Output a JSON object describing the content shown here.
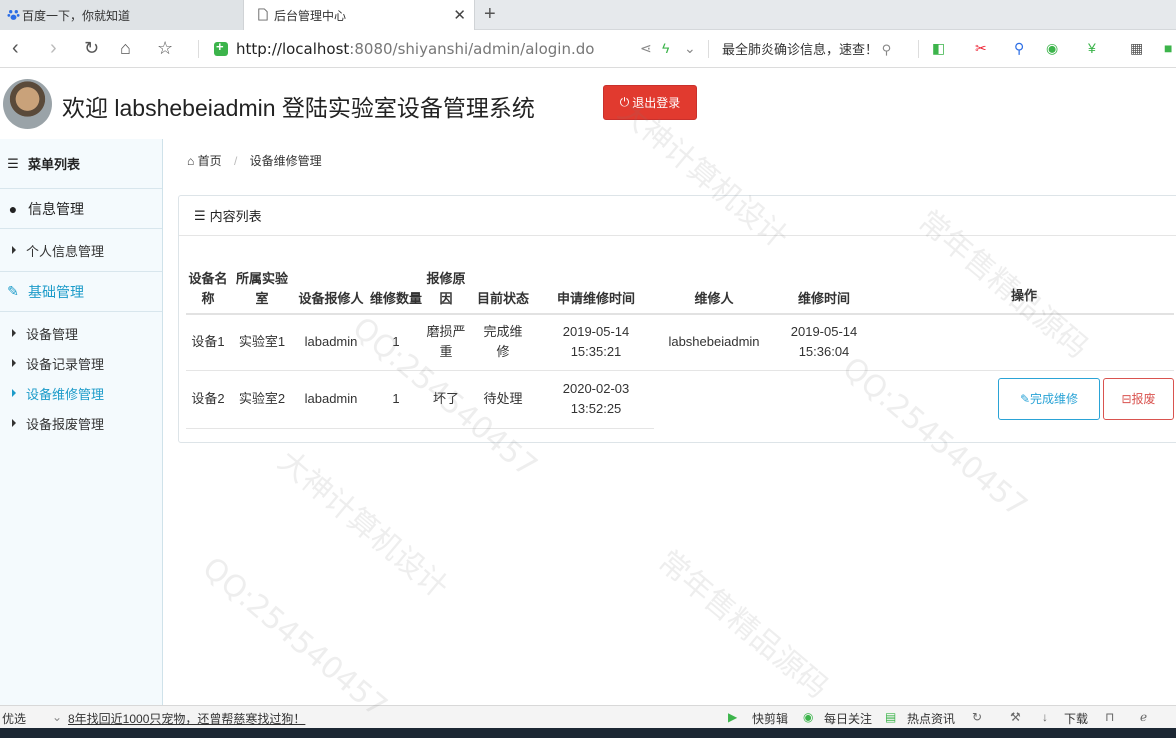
{
  "browser": {
    "tabs": [
      {
        "label": "百度一下，你就知道",
        "icon": "baidu-paw-icon"
      },
      {
        "label": "后台管理中心",
        "icon": "page-icon"
      }
    ],
    "url_host": "http://localhost",
    "url_rest": ":8080/shiyanshi/admin/alogin.do",
    "news_text": "最全肺炎确诊信息，速查！"
  },
  "header": {
    "welcome": "欢迎 labshebeiadmin 登陆实验室设备管理系统",
    "logout_label": "退出登录"
  },
  "sidebar": {
    "title": "菜单列表",
    "groups": [
      {
        "label": "信息管理",
        "items": [
          {
            "label": "个人信息管理"
          }
        ]
      },
      {
        "label": "基础管理",
        "items": [
          {
            "label": "设备管理"
          },
          {
            "label": "设备记录管理"
          },
          {
            "label": "设备维修管理"
          },
          {
            "label": "设备报废管理"
          }
        ]
      }
    ]
  },
  "breadcrumb": {
    "home": "首页",
    "current": "设备维修管理"
  },
  "panel": {
    "title": "内容列表",
    "columns": [
      "设备名称",
      "所属实验室",
      "设备报修人",
      "维修数量",
      "报修原因",
      "目前状态",
      "申请维修时间",
      "维修人",
      "维修时间",
      "操作"
    ],
    "rows": [
      {
        "name": "设备1",
        "lab": "实验室1",
        "reporter": "labadmin",
        "qty": "1",
        "reason": "磨损严重",
        "status": "完成维修",
        "apply_date": "2019-05-14",
        "apply_time": "15:35:21",
        "repairer": "labshebeiadmin",
        "repair_date": "2019-05-14",
        "repair_time": "15:36:04"
      },
      {
        "name": "设备2",
        "lab": "实验室2",
        "reporter": "labadmin",
        "qty": "1",
        "reason": "坏了",
        "status": "待处理",
        "apply_date": "2020-02-03",
        "apply_time": "13:52:25",
        "repairer": "",
        "repair_date": "",
        "repair_time": ""
      }
    ],
    "btn_done": "完成维修",
    "btn_scrap": "报废"
  },
  "statusbar": {
    "left": "优选",
    "news": "8年找回近1000只宠物，还曾帮慈寒找过狗！",
    "items": [
      "快剪辑",
      "每日关注",
      "热点资讯",
      "下载"
    ]
  },
  "watermarks": [
    "大神计算机设计",
    "QQ:254540457",
    "常年售精品源码"
  ],
  "colors": {
    "accent": "#1c9bc9",
    "logout": "#e13a2f",
    "scrap": "#d9534f",
    "sidebar_bg": "#f4fafd"
  }
}
